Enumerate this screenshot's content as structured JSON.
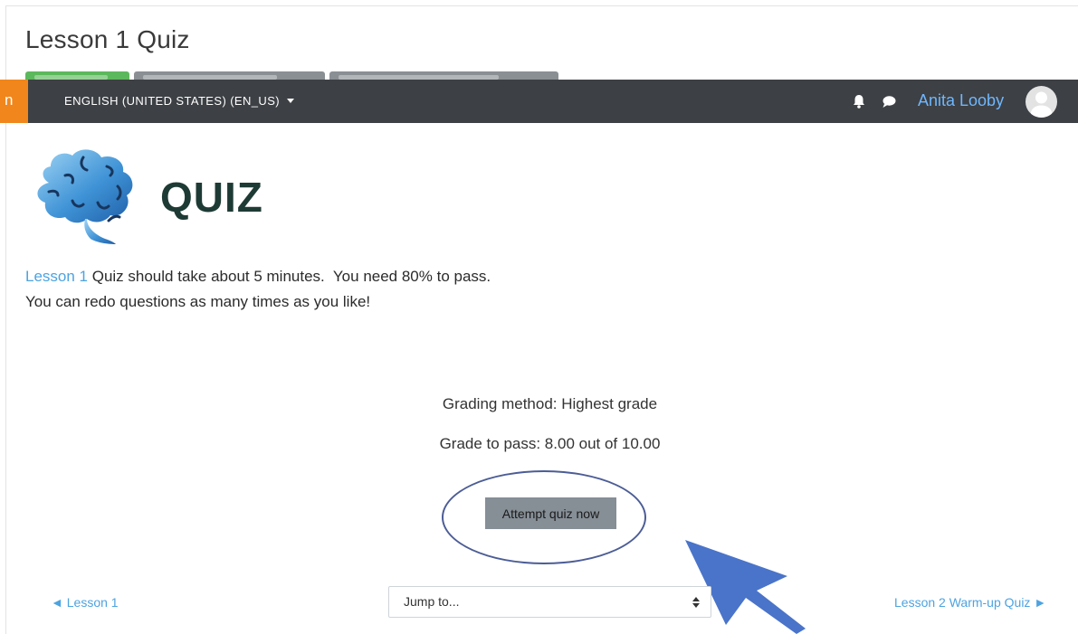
{
  "page": {
    "title": "Lesson 1 Quiz"
  },
  "navbar": {
    "brand_letter": "n",
    "language": "ENGLISH (UNITED STATES) (EN_US)",
    "user_name": "Anita Looby",
    "icons": [
      "bell-icon",
      "chat-icon",
      "avatar-icon"
    ]
  },
  "logo": {
    "text": "QUIZ"
  },
  "intro": {
    "lesson_link": "Lesson 1",
    "line1_rest": " Quiz should take about 5 minutes.  You need 80% to pass.",
    "line2": "You can redo questions as many times as you like!"
  },
  "quiz_info": {
    "grading_method": "Grading method: Highest grade",
    "grade_to_pass": "Grade to pass: 8.00 out of 10.00"
  },
  "actions": {
    "attempt_label": "Attempt quiz now"
  },
  "footer_nav": {
    "prev_label": "◄ Lesson 1",
    "jump_placeholder": "Jump to...",
    "next_label": "Lesson 2 Warm-up Quiz ►"
  },
  "colors": {
    "navbar_bg": "#3d4044",
    "brand_orange": "#f0861c",
    "link_blue": "#4da3e0",
    "button_gray": "#868e96",
    "annotation_blue": "#4a74c9"
  }
}
